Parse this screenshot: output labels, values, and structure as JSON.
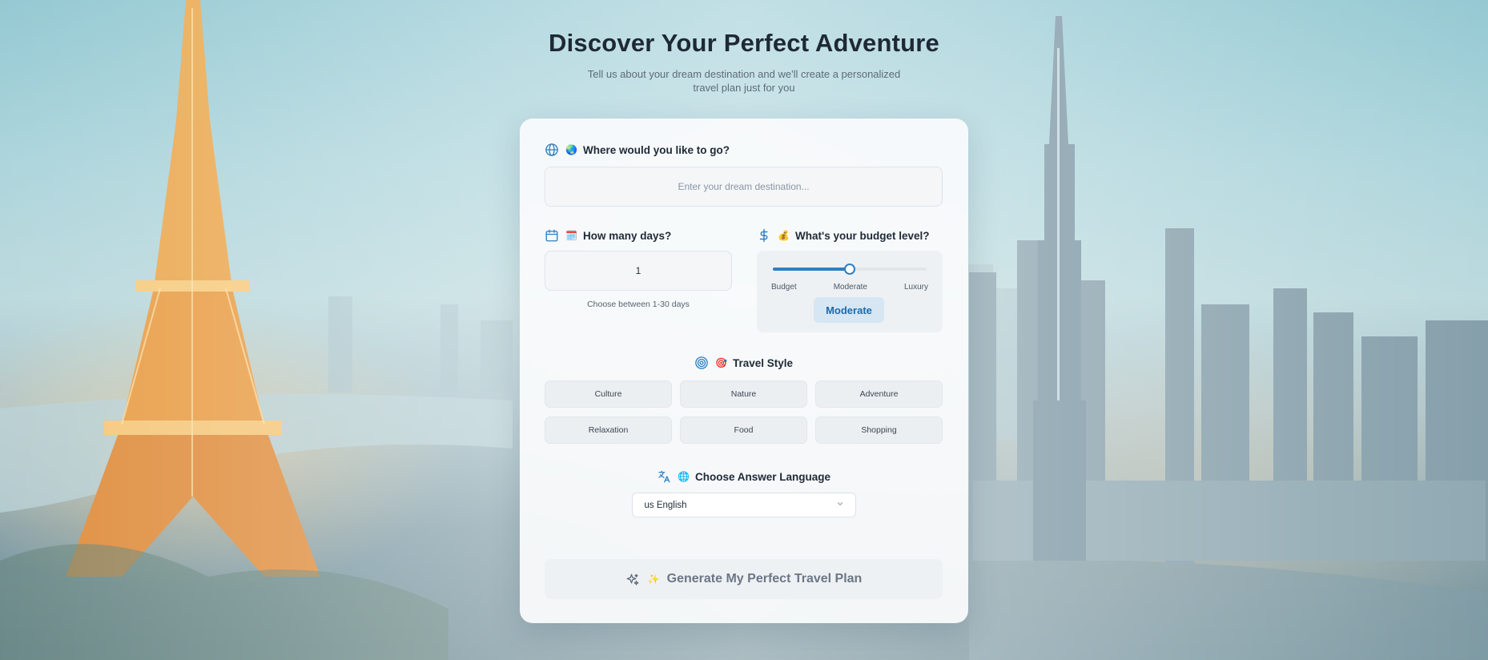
{
  "page": {
    "title": "Discover Your Perfect Adventure",
    "subtitle": "Tell us about your dream destination and we'll create a personalized travel plan just for you"
  },
  "destination": {
    "emoji": "🌏",
    "label": "Where would you like to go?",
    "placeholder": "Enter your dream destination...",
    "icon": "globe-icon"
  },
  "days": {
    "emoji": "🗓️",
    "label": "How many days?",
    "value": "1",
    "hint": "Choose between 1-30 days",
    "icon": "calendar-icon"
  },
  "budget": {
    "emoji": "💰",
    "label": "What's your budget level?",
    "icon": "dollar-icon",
    "levels": [
      "Budget",
      "Moderate",
      "Luxury"
    ],
    "selected": "Moderate",
    "slider_fraction": 0.5
  },
  "travel_style": {
    "emoji": "🎯",
    "label": "Travel Style",
    "icon": "target-icon",
    "options": [
      "Culture",
      "Nature",
      "Adventure",
      "Relaxation",
      "Food",
      "Shopping"
    ]
  },
  "language": {
    "emoji": "🌐",
    "label": "Choose Answer Language",
    "icon": "translate-icon",
    "selected": "us English"
  },
  "generate": {
    "emoji": "✨",
    "label": "Generate My Perfect Travel Plan",
    "icon": "sparkles-icon"
  },
  "colors": {
    "accent": "#2f7fbf",
    "title": "#1e2935"
  }
}
